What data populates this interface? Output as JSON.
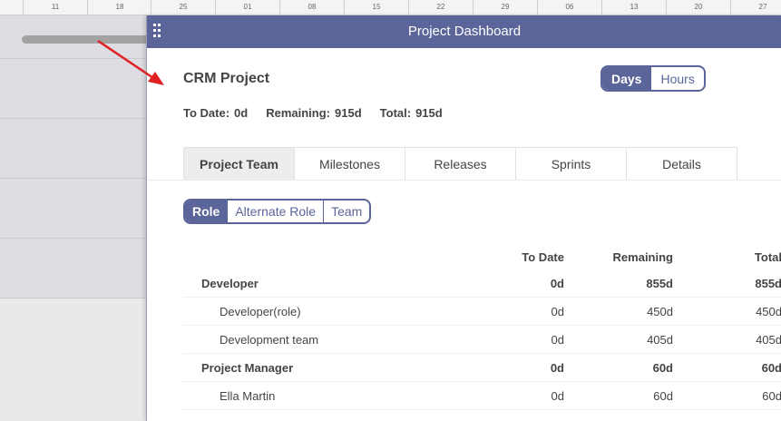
{
  "ruler": {
    "ticks": [
      {
        "label": "11"
      },
      {
        "label": "18"
      },
      {
        "label": "25"
      },
      {
        "label": "01"
      },
      {
        "label": "08"
      },
      {
        "label": "15"
      },
      {
        "label": "22"
      },
      {
        "label": "29"
      },
      {
        "label": "06"
      },
      {
        "label": "13"
      },
      {
        "label": "20"
      },
      {
        "label": "27"
      }
    ]
  },
  "dialog": {
    "title": "Project Dashboard",
    "project_name": "CRM Project",
    "unit_toggle": [
      "Days",
      "Hours"
    ],
    "stats": {
      "to_date_label": "To Date:",
      "to_date_value": "0d",
      "remaining_label": "Remaining:",
      "remaining_value": "915d",
      "total_label": "Total:",
      "total_value": "915d"
    },
    "tabs": [
      "Project Team",
      "Milestones",
      "Releases",
      "Sprints",
      "Details"
    ],
    "view_toggle": [
      "Role",
      "Alternate Role",
      "Team"
    ],
    "table": {
      "headers": [
        "To Date",
        "Remaining",
        "Total"
      ],
      "rows": [
        {
          "name": "Developer",
          "to_date": "0d",
          "remaining": "855d",
          "total": "855d"
        },
        {
          "name": "Developer(role)",
          "to_date": "0d",
          "remaining": "450d",
          "total": "450d"
        },
        {
          "name": "Development team",
          "to_date": "0d",
          "remaining": "405d",
          "total": "405d"
        },
        {
          "name": "Project Manager",
          "to_date": "0d",
          "remaining": "60d",
          "total": "60d"
        },
        {
          "name": "Ella Martin",
          "to_date": "0d",
          "remaining": "60d",
          "total": "60d"
        }
      ]
    }
  },
  "colors": {
    "header": "#5b6599",
    "arrow": "#e02020"
  }
}
